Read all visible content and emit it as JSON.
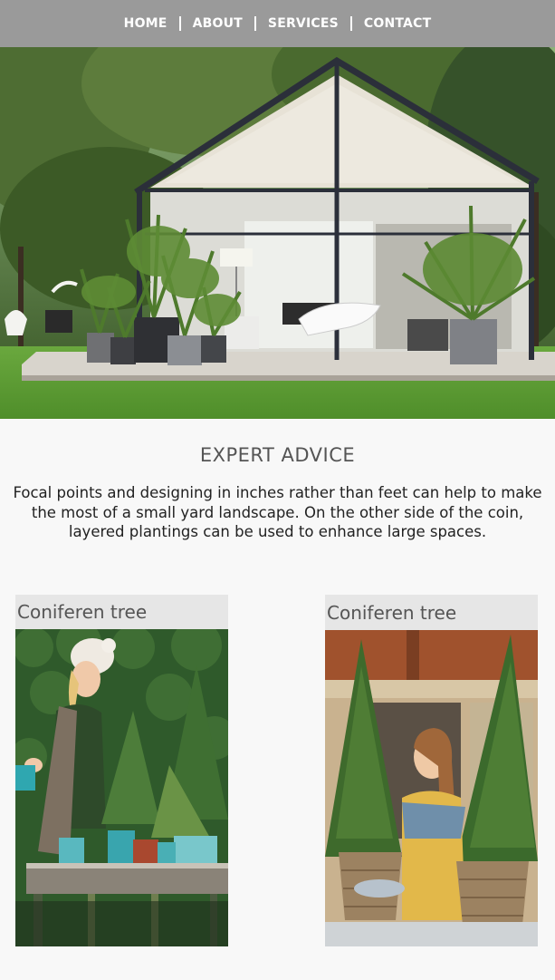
{
  "nav": {
    "items": [
      {
        "label": "HOME"
      },
      {
        "label": "ABOUT"
      },
      {
        "label": "SERVICES"
      },
      {
        "label": "CONTACT"
      }
    ]
  },
  "hero": {
    "image": "glass-house-garden-photo"
  },
  "main": {
    "headline": "EXPERT ADVICE",
    "intro": "Focal points and designing in inches rather than feet can help to make the most of a small yard landscape. On the other side of the coin, layered plantings can be used to enhance large spaces."
  },
  "cards": [
    {
      "title": "Coniferen tree",
      "image": "woman-with-potted-conifers-photo"
    },
    {
      "title": "Coniferen tree",
      "image": "woman-with-basket-conifers-photo"
    }
  ],
  "colors": {
    "nav_bg": "#9a9a9a",
    "page_bg": "#f8f8f8",
    "card_title_bg": "#e6e6e6"
  }
}
